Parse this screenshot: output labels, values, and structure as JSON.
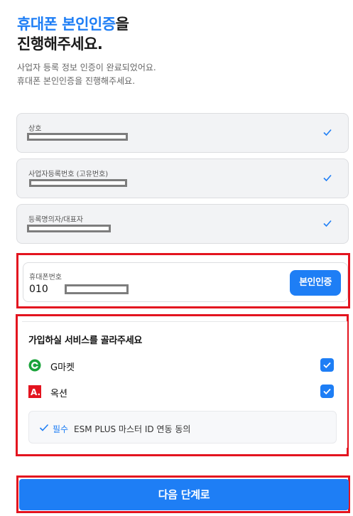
{
  "header": {
    "title_accent": "휴대폰 본인인증",
    "title_suffix": "을",
    "title_line2": "진행해주세요.",
    "subtitle_line1": "사업자 등록 정보 인증이 완료되었어요.",
    "subtitle_line2": "휴대폰 본인인증을 진행해주세요."
  },
  "fields": [
    {
      "label": "상호",
      "value": "[redacted]",
      "verified": true
    },
    {
      "label": "사업자등록번호 (고유번호)",
      "value": "[redacted]",
      "verified": true
    },
    {
      "label": "등록명의자/대표자",
      "value": "[redacted]",
      "verified": true
    }
  ],
  "phone": {
    "label": "휴대폰번호",
    "value_prefix": "010",
    "value_rest": "[redacted]",
    "verify_button": "본인인증"
  },
  "services": {
    "heading": "가입하실 서비스를 골라주세요",
    "items": [
      {
        "name": "G마켓",
        "icon": "gmarket-logo-icon",
        "checked": true,
        "color": "#1aa33a"
      },
      {
        "name": "옥션",
        "icon": "auction-logo-icon",
        "checked": true,
        "color": "#e3141f"
      }
    ],
    "consent": {
      "required": "필수",
      "text": "ESM PLUS 마스터 ID 연동 동의",
      "checked": true
    }
  },
  "next_button": "다음 단계로",
  "colors": {
    "accent": "#1e7ef5",
    "highlight": "#e3141f"
  }
}
